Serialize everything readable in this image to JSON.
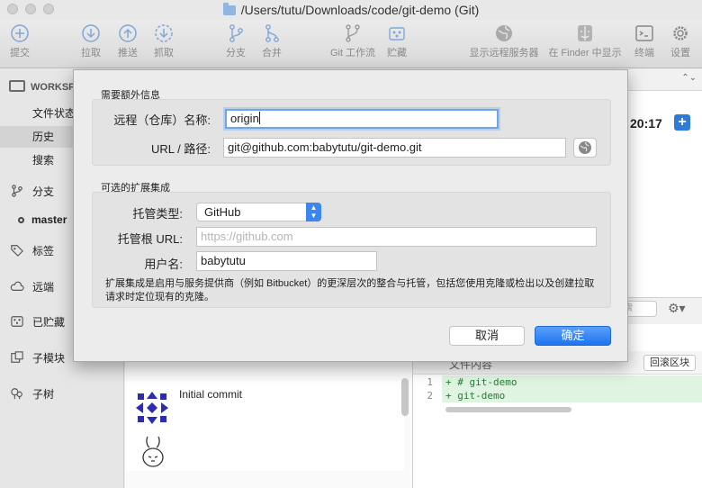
{
  "window": {
    "title": "/Users/tutu/Downloads/code/git-demo (Git)"
  },
  "toolbar": {
    "commit": "提交",
    "pull": "拉取",
    "push": "推送",
    "fetch": "抓取",
    "branch": "分支",
    "merge": "合并",
    "git_flow": "Git 工作流",
    "stash": "贮藏",
    "show_remote": "显示远程服务器",
    "show_in_finder": "在 Finder 中显示",
    "terminal": "终端",
    "settings": "设置"
  },
  "sidebar": {
    "workspace": "WORKSPACE",
    "file_status": "文件状态",
    "history": "历史",
    "search": "搜索",
    "branches": "分支",
    "master": "master",
    "tags": "标签",
    "remotes": "远端",
    "stashes": "已贮藏",
    "submodules": "子模块",
    "subtrees": "子树"
  },
  "main": {
    "time": "20:17",
    "search_placeholder": "搜索",
    "commit_message": "Initial commit",
    "diff_title": "文件内容",
    "rollback_button": "回滚区块",
    "diff_lines": [
      {
        "num": "1",
        "code": "+ # git-demo"
      },
      {
        "num": "2",
        "code": "+ git-demo"
      }
    ]
  },
  "dialog": {
    "section_required": "需要额外信息",
    "remote_name_label": "远程（仓库）名称:",
    "remote_name_value": "origin",
    "url_label": "URL / 路径:",
    "url_value": "git@github.com:babytutu/git-demo.git",
    "section_optional": "可选的扩展集成",
    "host_type_label": "托管类型:",
    "host_type_value": "GitHub",
    "host_root_label": "托管根 URL:",
    "host_root_placeholder": "https://github.com",
    "username_label": "用户名:",
    "username_value": "babytutu",
    "description": "扩展集成是启用与服务提供商（例如 Bitbucket）的更深层次的整合与托管，包括您使用克隆或检出以及创建拉取请求时定位现有的克隆。",
    "cancel": "取消",
    "ok": "确定"
  }
}
